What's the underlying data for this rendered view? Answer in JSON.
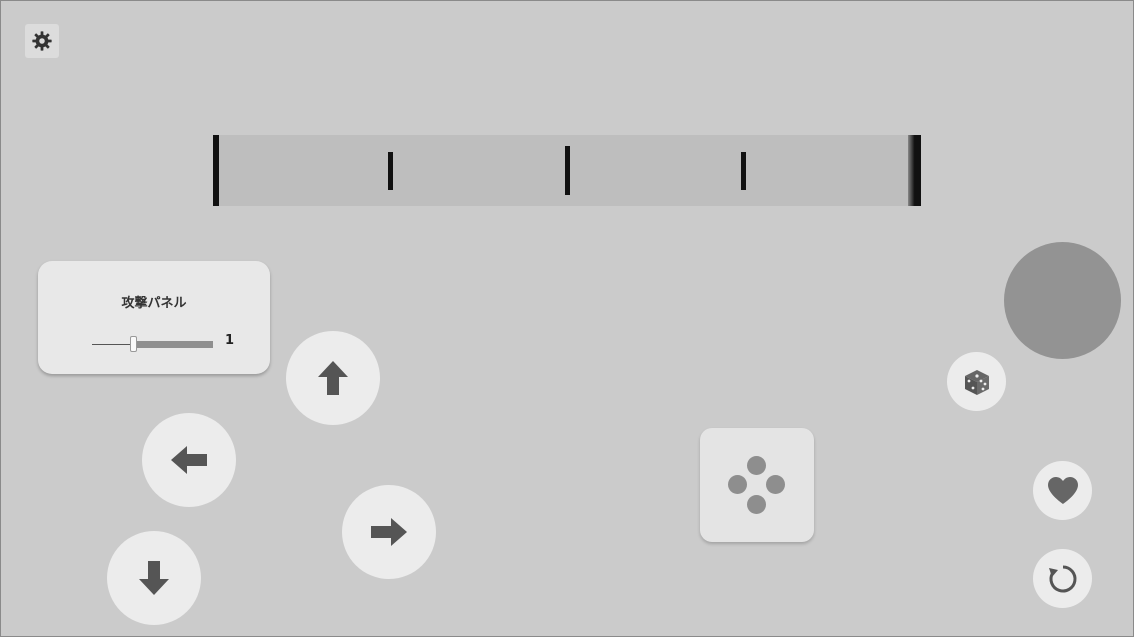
{
  "attack_panel": {
    "title": "攻撃パネル",
    "slider_value": "1",
    "slider_fraction": 0.33
  },
  "gauge": {
    "tick_count": 5
  },
  "controls": {
    "settings_icon": "gear-icon",
    "dpad": [
      "arrow-up-icon",
      "arrow-left-icon",
      "arrow-right-icon",
      "arrow-down-icon"
    ],
    "action_pad_icon": "four-dots-icon",
    "side_icons": [
      "dice-icon",
      "heart-icon",
      "reload-icon"
    ]
  },
  "colors": {
    "background": "#cbcbcb",
    "button": "#ececec",
    "icon": "#555555",
    "joystick": "#939393"
  }
}
